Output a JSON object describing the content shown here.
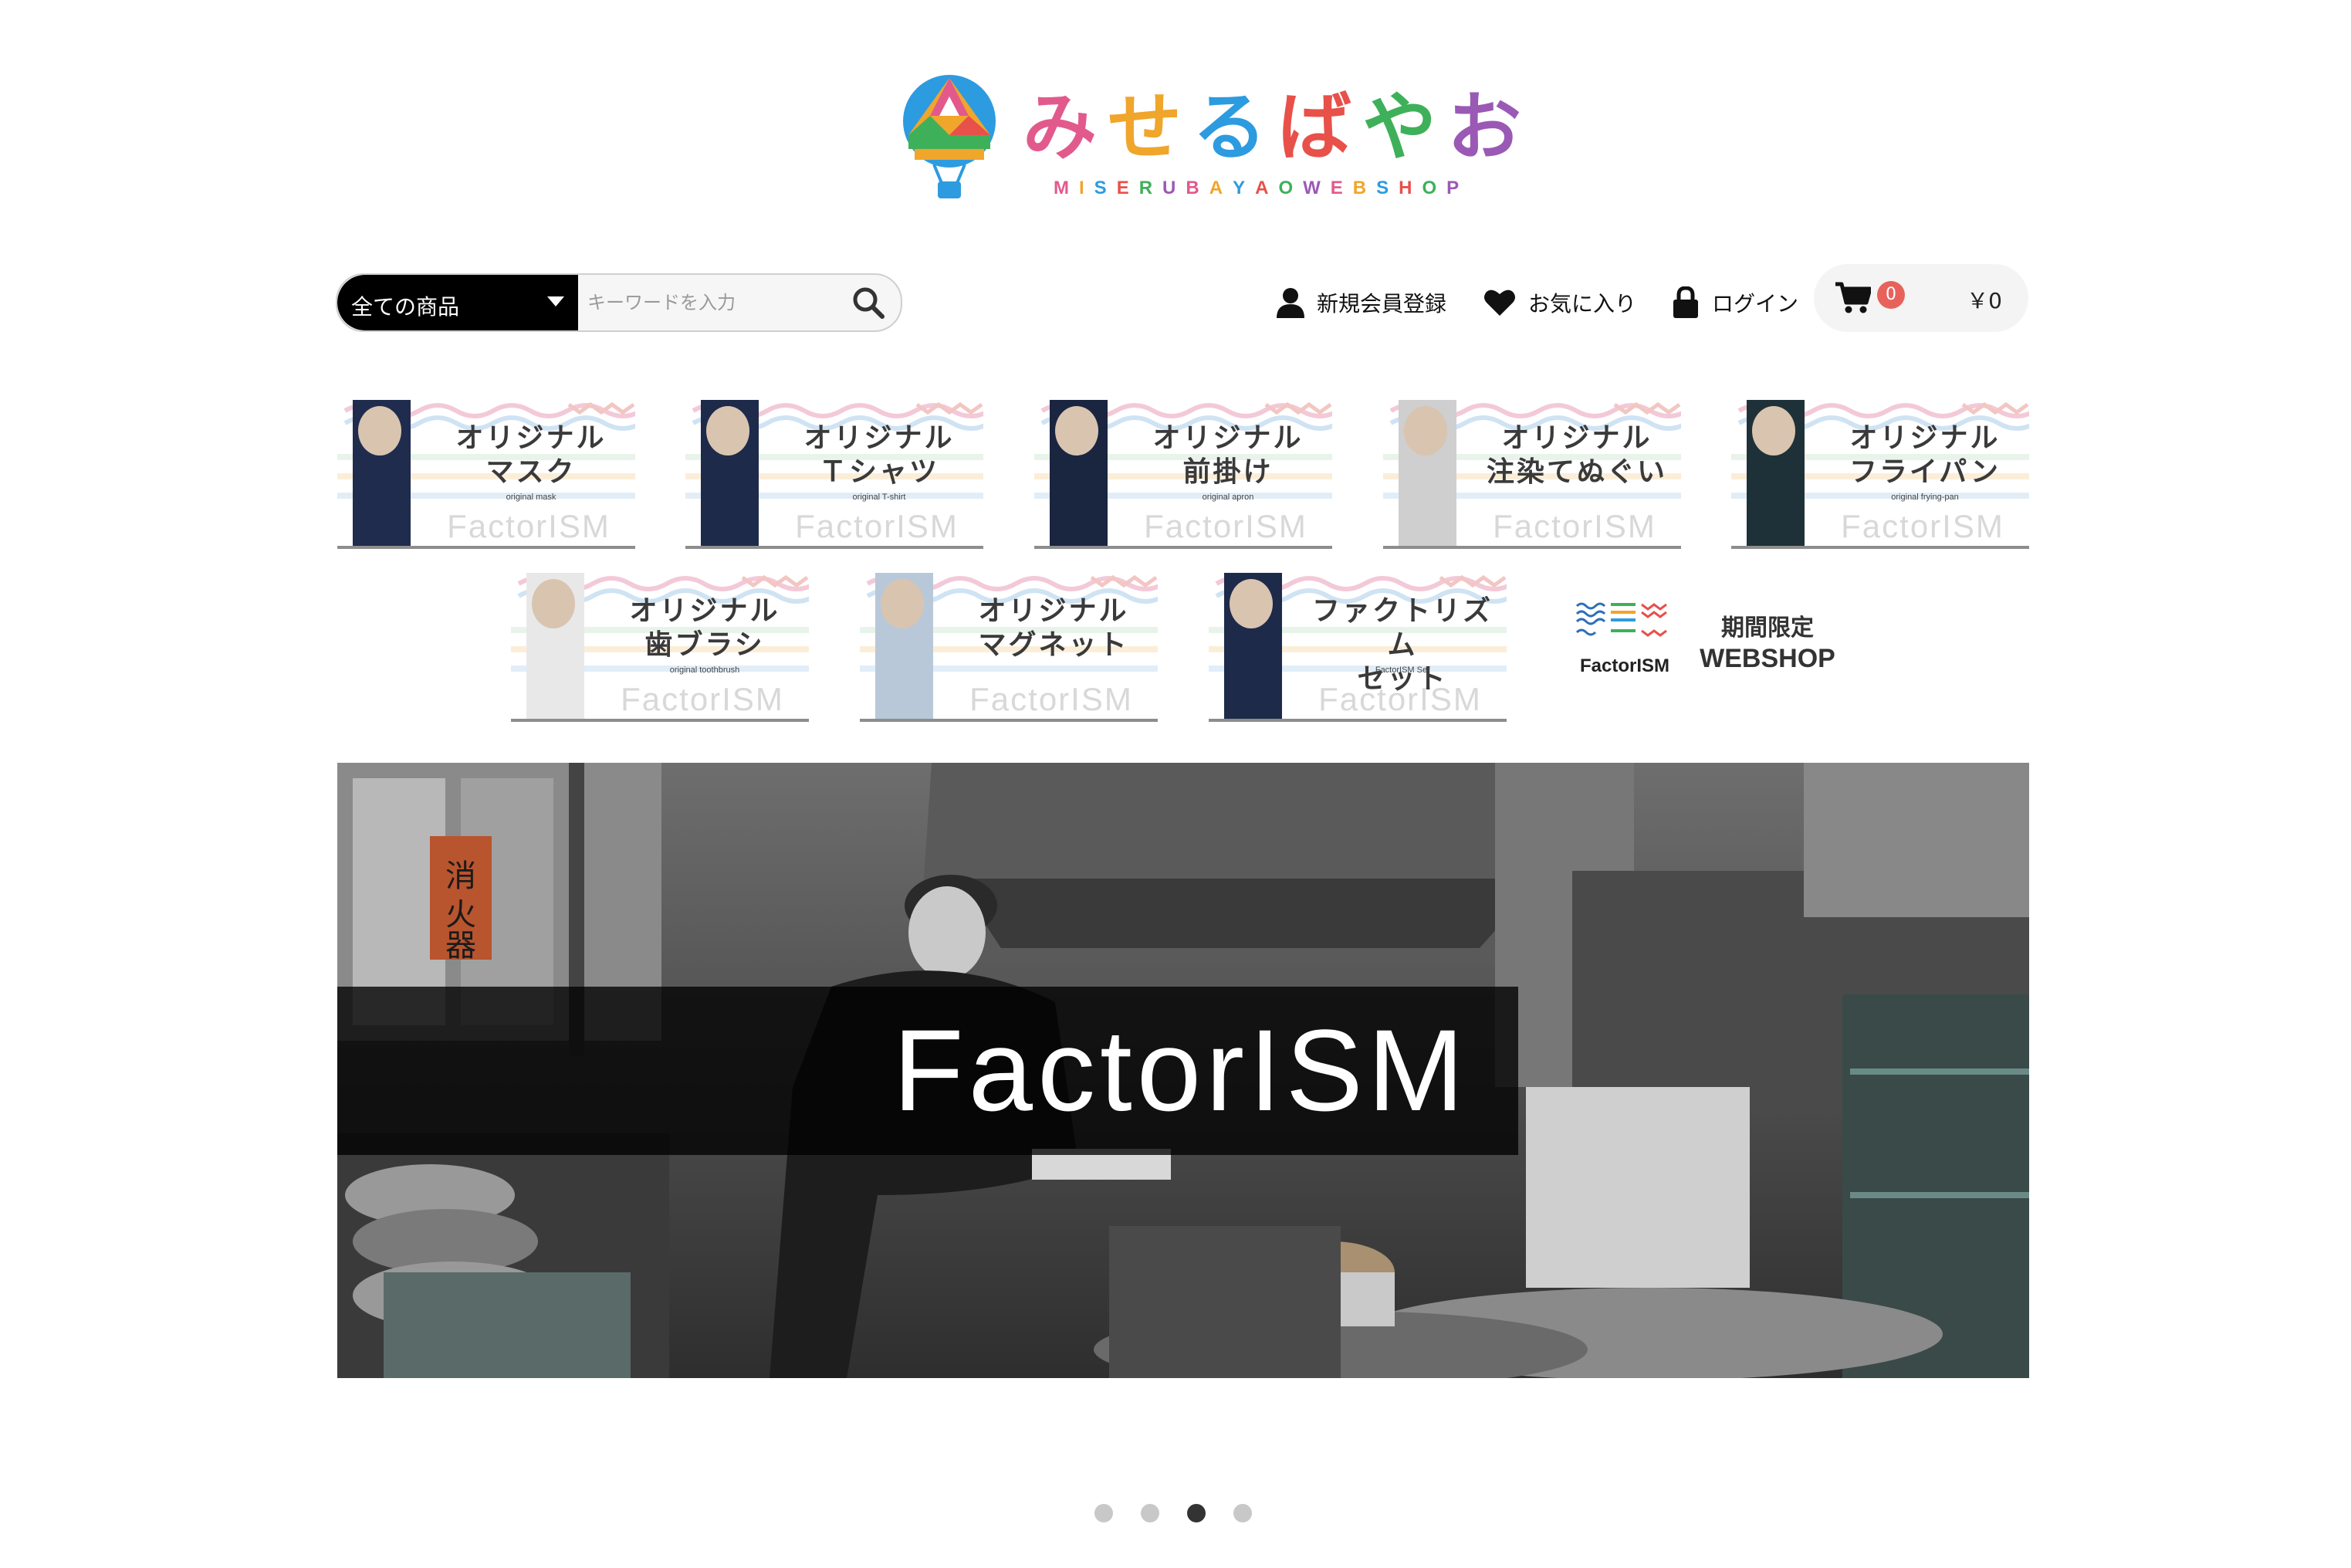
{
  "logo": {
    "kana": [
      "み",
      "せ",
      "る",
      "ば",
      "や",
      "お"
    ],
    "kana_colors": [
      "#e25a8c",
      "#f0a52b",
      "#2d9be0",
      "#e8504a",
      "#3fb05a",
      "#9b59b6"
    ],
    "subtitle": [
      "M",
      "I",
      "S",
      "E",
      "R",
      "U",
      "B",
      "A",
      "Y",
      "A",
      "O",
      "W",
      "E",
      "B",
      "S",
      "H",
      "O",
      "P"
    ],
    "subtitle_colors": [
      "#e25a8c",
      "#f0a52b",
      "#2d9be0",
      "#e8504a",
      "#3fb05a",
      "#9b59b6",
      "#e25a8c",
      "#f0a52b",
      "#2d9be0",
      "#e8504a",
      "#3fb05a",
      "#9b59b6",
      "#e25a8c",
      "#f0a52b",
      "#2d9be0",
      "#e8504a",
      "#3fb05a",
      "#9b59b6"
    ]
  },
  "search": {
    "category_label": "全ての商品",
    "placeholder": "キーワードを入力"
  },
  "nav": {
    "register_label": "新規会員登録",
    "favorites_label": "お気に入り",
    "login_label": "ログイン"
  },
  "cart": {
    "count": "0",
    "total": "￥0"
  },
  "banners": [
    {
      "title_1": "オリジナル",
      "title_2": "マスク",
      "sub": "original mask",
      "brand": "FactorISM"
    },
    {
      "title_1": "オリジナル",
      "title_2": "Ｔシャツ",
      "sub": "original T-shirt",
      "brand": "FactorISM"
    },
    {
      "title_1": "オリジナル",
      "title_2": "前掛け",
      "sub": "original apron",
      "brand": "FactorISM"
    },
    {
      "title_1": "オリジナル",
      "title_2": "注染てぬぐい",
      "sub": "",
      "brand": "FactorISM"
    },
    {
      "title_1": "オリジナル",
      "title_2": "フライパン",
      "sub": "original frying-pan",
      "brand": "FactorISM"
    },
    {
      "title_1": "オリジナル",
      "title_2": "歯ブラシ",
      "sub": "original toothbrush",
      "brand": "FactorISM"
    },
    {
      "title_1": "オリジナル",
      "title_2": "マグネット",
      "sub": "",
      "brand": "FactorISM"
    },
    {
      "title_1": "ファクトリズム",
      "title_2": "セット",
      "sub": "FactorISM Set",
      "brand": "FactorISM"
    }
  ],
  "promo": {
    "line_1": "期間限定",
    "line_2": "WEBSHOP",
    "logo_text": "FactorISM"
  },
  "hero": {
    "brand": "FactorISM",
    "sign": "消火器"
  },
  "carousel": {
    "slides": 4,
    "active_index": 2
  },
  "colors": {
    "badge": "#e8625c",
    "category_bg": "#000000"
  }
}
